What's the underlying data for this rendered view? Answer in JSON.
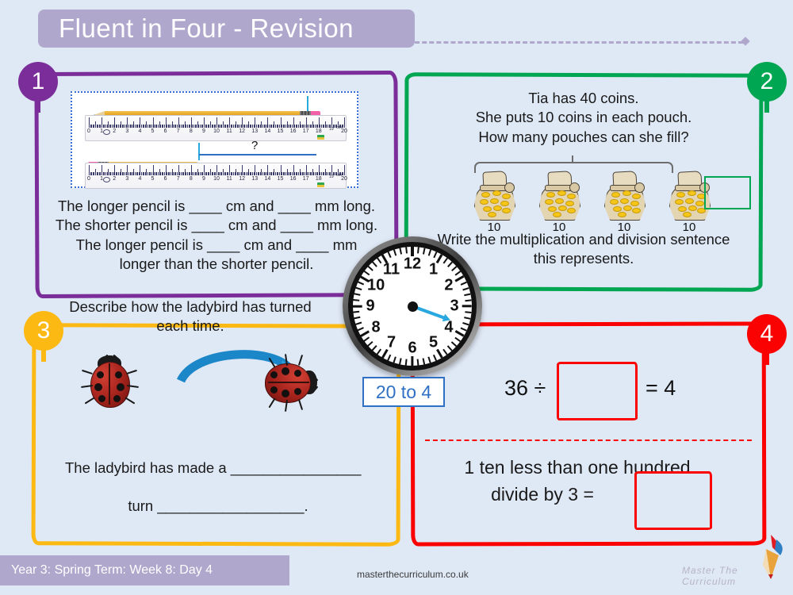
{
  "header": {
    "title": "Fluent in Four - Revision"
  },
  "sections": [
    {
      "number": "1",
      "color": "#7b2d99",
      "lines": [
        "The longer pencil is ____ cm and ____ mm long.",
        "The shorter pencil is ____ cm and ____ mm long.",
        "The longer pencil is ____ cm and ____ mm",
        "longer than the shorter pencil."
      ],
      "ruler": {
        "unit_label": "cm",
        "max": 20,
        "tick_labels": [
          "0",
          "1",
          "2",
          "3",
          "4",
          "5",
          "6",
          "7",
          "8",
          "9",
          "10",
          "11",
          "12",
          "13",
          "14",
          "15",
          "16",
          "17",
          "18",
          "19",
          "20"
        ],
        "long_pencil_cm": 18.4,
        "short_pencil_cm": 9.5,
        "question_mark": "?"
      }
    },
    {
      "number": "2",
      "color": "#00a651",
      "lines": [
        "Tia has 40 coins.",
        "She puts 10 coins in each pouch.",
        "How many pouches can she fill?"
      ],
      "pouch_labels": [
        "10",
        "10",
        "10",
        "10"
      ],
      "footer_lines": [
        "Write the multiplication and division sentence",
        "this represents."
      ],
      "answer_box": ""
    },
    {
      "number": "3",
      "color": "#fdb913",
      "prompt_lines": [
        "Describe how the ladybird has turned",
        "each time."
      ],
      "answer_lines": [
        {
          "prefix": "The ladybird has made a ",
          "blank": "________________",
          "suffix": ""
        },
        {
          "prefix": "turn ",
          "blank": "__________________",
          "suffix": "."
        }
      ]
    },
    {
      "number": "4",
      "color": "#fa0202",
      "question_a": {
        "left": "36 ÷",
        "box": "",
        "right": "= 4"
      },
      "question_b": {
        "line1": "1 ten less than one hundred",
        "line2": "divide by 3 =",
        "box": ""
      }
    }
  ],
  "clock": {
    "hour_numbers": [
      "12",
      "1",
      "2",
      "3",
      "4",
      "5",
      "6",
      "7",
      "8",
      "9",
      "10",
      "11"
    ],
    "hand_angle_deg": 20,
    "time_label": "20 to 4"
  },
  "footer": {
    "term_info": "Year 3: Spring Term: Week 8: Day 4",
    "url": "masterthecurriculum.co.uk",
    "logo_text": "Master The Curriculum"
  }
}
